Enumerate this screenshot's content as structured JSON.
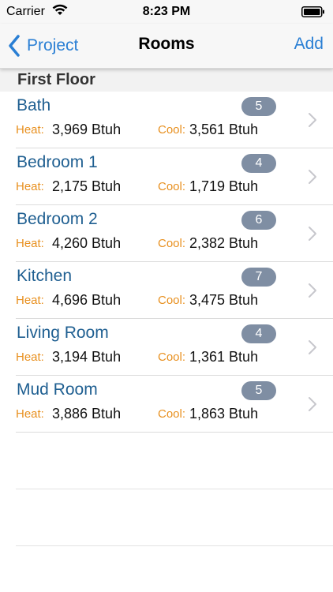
{
  "status_bar": {
    "carrier": "Carrier",
    "time": "8:23 PM"
  },
  "nav": {
    "back_label": "Project",
    "title": "Rooms",
    "add_label": "Add"
  },
  "section": {
    "title": "First Floor"
  },
  "labels": {
    "heat": "Heat:",
    "cool": "Cool:"
  },
  "rooms": [
    {
      "name": "Bath",
      "count": "5",
      "heat": "3,969 Btuh",
      "cool": "3,561 Btuh"
    },
    {
      "name": "Bedroom 1",
      "count": "4",
      "heat": "2,175 Btuh",
      "cool": "1,719 Btuh"
    },
    {
      "name": "Bedroom 2",
      "count": "6",
      "heat": "4,260 Btuh",
      "cool": "2,382 Btuh"
    },
    {
      "name": "Kitchen",
      "count": "7",
      "heat": "4,696 Btuh",
      "cool": "3,475 Btuh"
    },
    {
      "name": "Living Room",
      "count": "4",
      "heat": "3,194 Btuh",
      "cool": "1,361 Btuh"
    },
    {
      "name": "Mud Room",
      "count": "5",
      "heat": "3,886 Btuh",
      "cool": "1,863 Btuh"
    }
  ],
  "colors": {
    "accent": "#2a7fd4",
    "room_name": "#1f5f91",
    "label_orange": "#e8901f",
    "badge": "#7f8ea3"
  },
  "icons": {
    "back": "chevron-left-icon",
    "disclosure": "chevron-right-icon",
    "wifi": "wifi-icon",
    "battery": "battery-icon"
  }
}
